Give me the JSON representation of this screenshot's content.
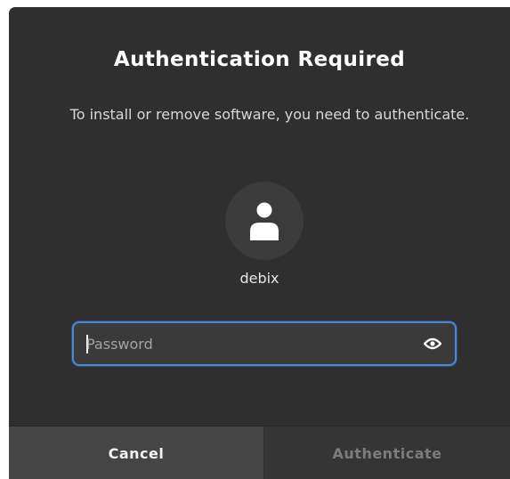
{
  "dialog": {
    "title": "Authentication Required",
    "message": "To install or remove software, you need to authenticate.",
    "user": {
      "avatar_icon": "user-avatar-icon",
      "name": "debix"
    },
    "password_field": {
      "value": "",
      "placeholder": "Password",
      "reveal_icon": "eye-icon",
      "focused": true
    },
    "buttons": {
      "cancel_label": "Cancel",
      "authenticate_label": "Authenticate",
      "authenticate_enabled": false
    }
  },
  "colors": {
    "dialog_background": "#2f2f2f",
    "focus_ring": "#4e85d1",
    "cancel_background": "#454545",
    "disabled_text": "#7c7c7c"
  }
}
